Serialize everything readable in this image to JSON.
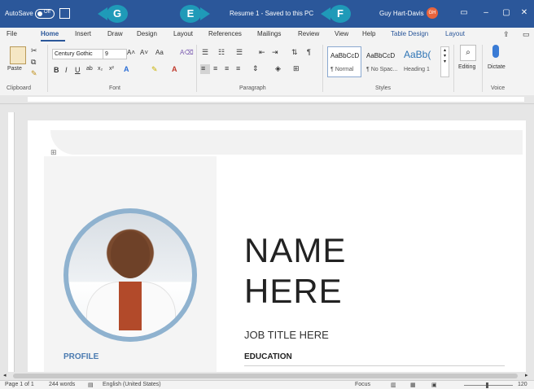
{
  "titlebar": {
    "autosave_label": "AutoSave",
    "autosave_state": "Off",
    "doc_title": "Resume 1 - Saved to this PC",
    "user_name": "Guy Hart-Davis",
    "user_initials": "GH",
    "callouts": [
      "G",
      "E",
      "F"
    ],
    "accent_color": "#2b579a",
    "callout_color": "#1f9ab8"
  },
  "menu": {
    "tabs": [
      "File",
      "Home",
      "Insert",
      "Draw",
      "Design",
      "Layout",
      "References",
      "Mailings",
      "Review",
      "View",
      "Help",
      "Table Design",
      "Layout"
    ],
    "active_tab": "Home"
  },
  "ribbon": {
    "clipboard": {
      "paste_label": "Paste",
      "group_label": "Clipboard"
    },
    "font": {
      "font_name": "Century Gothic",
      "font_size": "9",
      "group_label": "Font"
    },
    "paragraph": {
      "group_label": "Paragraph"
    },
    "styles": {
      "items": [
        {
          "preview": "AaBbCcD",
          "name": "¶ Normal"
        },
        {
          "preview": "AaBbCcD",
          "name": "¶ No Spac..."
        },
        {
          "preview": "AaBb(",
          "name": "Heading 1"
        }
      ],
      "group_label": "Styles"
    },
    "editing_label": "Editing",
    "dictate_label": "Dictate",
    "voice_label": "Voice"
  },
  "document": {
    "name_line1": "NAME",
    "name_line2": "HERE",
    "job_title": "JOB TITLE HERE",
    "education_heading": "EDUCATION",
    "profile_heading": "PROFILE"
  },
  "status": {
    "page": "Page 1 of 1",
    "words": "244 words",
    "language": "English (United States)",
    "focus": "Focus",
    "zoom": "120"
  }
}
